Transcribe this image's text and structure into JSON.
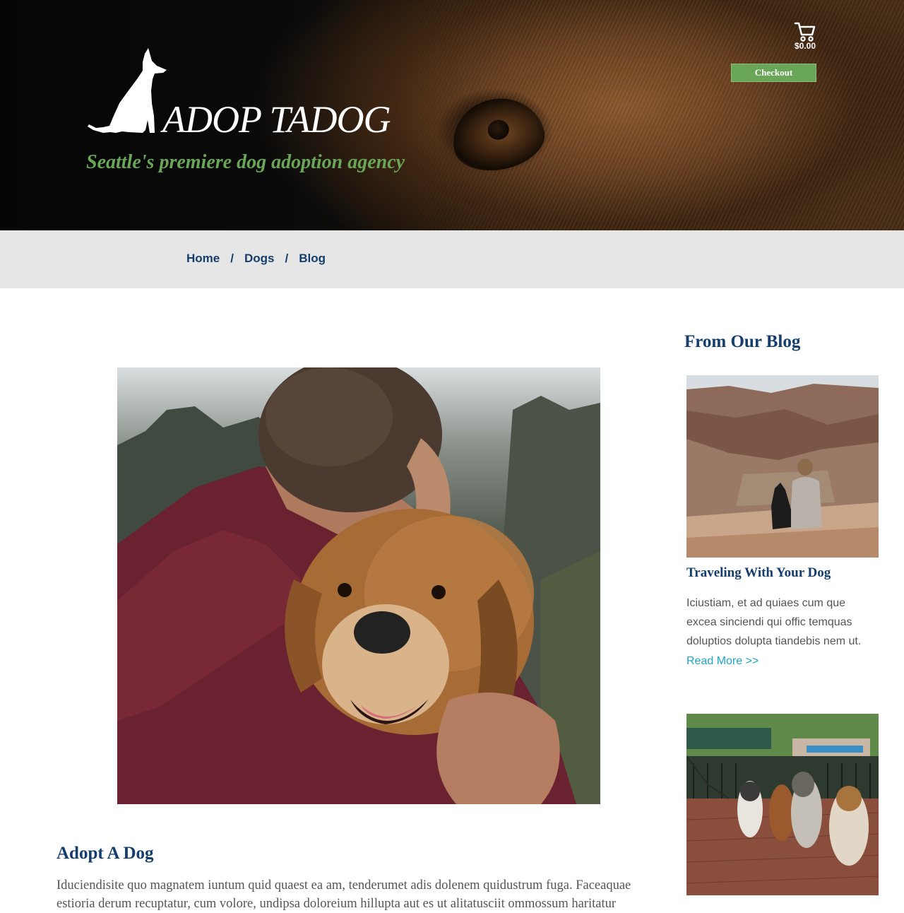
{
  "header": {
    "logo_text": "ADOP TADOG",
    "tagline": "Seattle's premiere dog adoption agency",
    "cart_total": "$0.00",
    "checkout_label": "Checkout"
  },
  "nav": {
    "items": [
      {
        "label": "Home"
      },
      {
        "label": "Dogs"
      },
      {
        "label": "Blog"
      }
    ],
    "separator": "/"
  },
  "main": {
    "article_title": "Adopt A Dog",
    "article_body": "Iduciendisite quo magnatem iuntum quid quaest ea am, tenderumet adis dolenem quidustrum fuga. Faceaquae estioria derum recuptatur, cum volore, undipsa doloreium hillupta aut es ut alitatusciit ommossum haritatur"
  },
  "sidebar": {
    "title": "From Our Blog",
    "posts": [
      {
        "title": "Traveling With Your Dog",
        "excerpt": "Iciustiam, et ad quiaes cum que excea sinciendi qui offic temquas doluptios dolupta tiandebis nem ut.",
        "read_more": "Read More >>"
      }
    ]
  },
  "colors": {
    "brand_navy": "#153e6c",
    "brand_green": "#6aa657",
    "link_cyan": "#1fa4c6",
    "nav_bg": "#e6e6e6",
    "body_text": "#555555"
  },
  "icons": [
    "dog-silhouette-icon",
    "cart-icon"
  ]
}
